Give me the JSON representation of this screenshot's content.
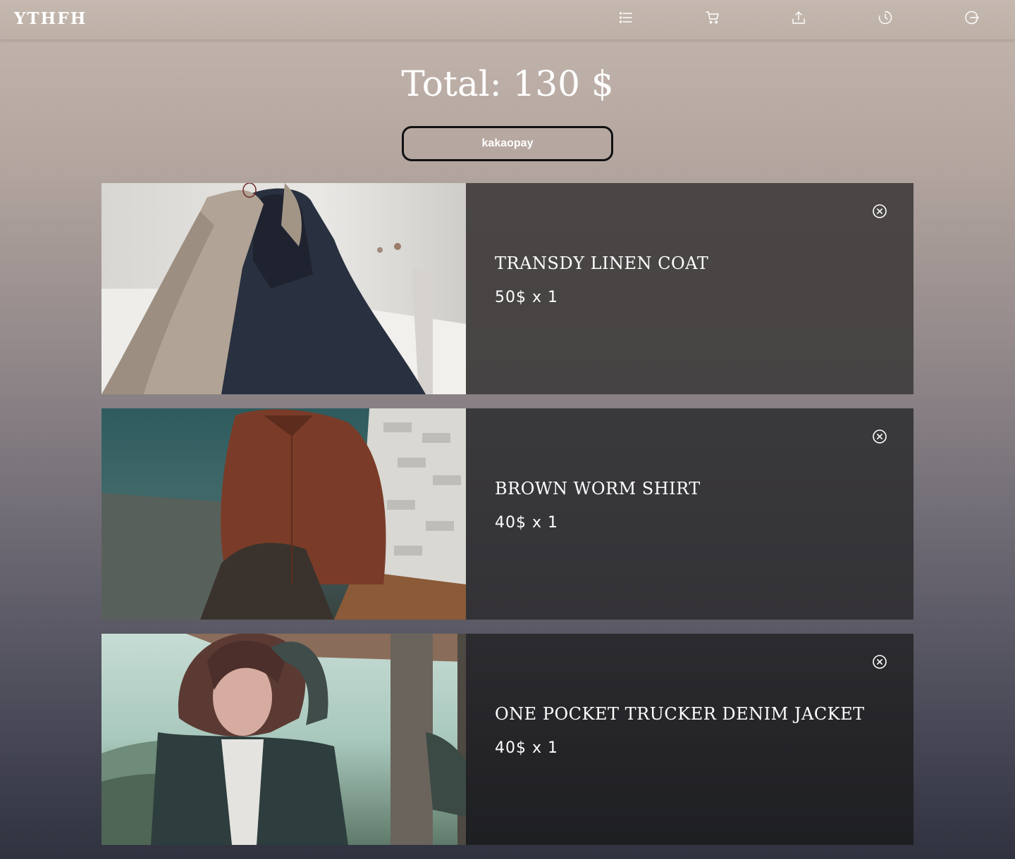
{
  "header": {
    "logo": "YTHFH",
    "nav": [
      {
        "name": "list-icon"
      },
      {
        "name": "cart-icon"
      },
      {
        "name": "upload-icon"
      },
      {
        "name": "history-icon"
      },
      {
        "name": "logout-icon"
      }
    ]
  },
  "cart": {
    "total": "Total: 130 $",
    "pay_label": "kakaopay",
    "items": [
      {
        "name": "TRANSDY LINEN COAT",
        "price": "50$  x 1"
      },
      {
        "name": "BROWN WORM SHIRT",
        "price": "40$  x 1"
      },
      {
        "name": "ONE POCKET TRUCKER DENIM JACKET",
        "price": "40$  x 1"
      }
    ]
  },
  "colors": {
    "text": "#ffffff",
    "button_border": "#111111"
  }
}
